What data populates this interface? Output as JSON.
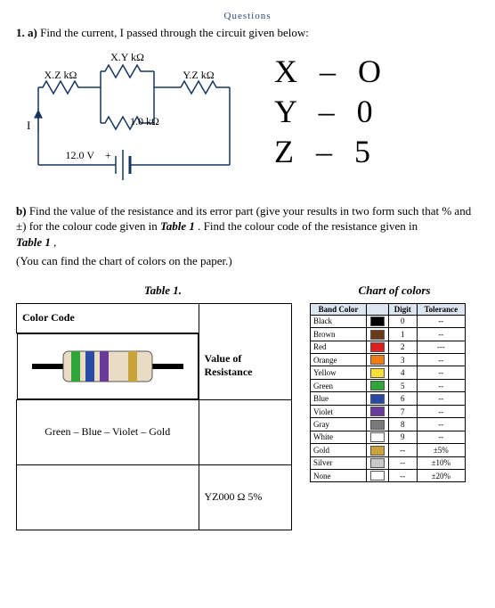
{
  "header_small": "Questions",
  "q1a": {
    "label": "1. a)",
    "text": "Find the current, I passed through the circuit given below:"
  },
  "circuit": {
    "r_top": "X.Y kΩ",
    "r_left": "X.Z kΩ",
    "r_right": "Y.Z kΩ",
    "r_mid": "1.0 kΩ",
    "v_src": "12.0 V",
    "i_label": "I"
  },
  "handnotes": {
    "l1a": "X",
    "l1b": "–",
    "l1c": "O",
    "l2a": "Y",
    "l2b": "–",
    "l2c": "0",
    "l3a": "Z",
    "l3b": "–",
    "l3c": "5"
  },
  "q1b": {
    "label": "b)",
    "text1": "Find the value of the resistance and its error part (give your results in two form such that % and ±) for the colour code given in ",
    "tbl_ref1": "Table 1",
    "text2": ".  Find the colour code of the resistance given in ",
    "tbl_ref2": "Table 1",
    "text3": ",",
    "note": "(You can find the chart of colors on the paper.)"
  },
  "table1": {
    "title": "Table 1.",
    "hdr1": "Color Code",
    "hdr2_l1": "Value of",
    "hdr2_l2": "Resistance",
    "row1_code": "Green – Blue – Violet – Gold",
    "row2_value": "YZ000 Ω 5%"
  },
  "chart": {
    "title": "Chart of colors",
    "h1": "Band Color",
    "h2": "Digit",
    "h3": "Tolerance",
    "rows": [
      {
        "name": "Black",
        "c": "#000000",
        "d": "0",
        "t": "--"
      },
      {
        "name": "Brown",
        "c": "#6b3a1a",
        "d": "1",
        "t": "--"
      },
      {
        "name": "Red",
        "c": "#e02020",
        "d": "2",
        "t": "---"
      },
      {
        "name": "Orange",
        "c": "#f07d1a",
        "d": "3",
        "t": "--"
      },
      {
        "name": "Yellow",
        "c": "#f5e03a",
        "d": "4",
        "t": "--"
      },
      {
        "name": "Green",
        "c": "#2fa53a",
        "d": "5",
        "t": "--"
      },
      {
        "name": "Blue",
        "c": "#2a4aa5",
        "d": "6",
        "t": "--"
      },
      {
        "name": "Violet",
        "c": "#6a3a9a",
        "d": "7",
        "t": "--"
      },
      {
        "name": "Gray",
        "c": "#7a7a7a",
        "d": "8",
        "t": "--"
      },
      {
        "name": "White",
        "c": "#ffffff",
        "d": "9",
        "t": "--"
      },
      {
        "name": "Gold",
        "c": "#c9a23a",
        "d": "--",
        "t": "±5%"
      },
      {
        "name": "Silver",
        "c": "#c8c8c8",
        "d": "--",
        "t": "±10%"
      },
      {
        "name": "None",
        "c": "",
        "d": "--",
        "t": "±20%"
      }
    ]
  }
}
